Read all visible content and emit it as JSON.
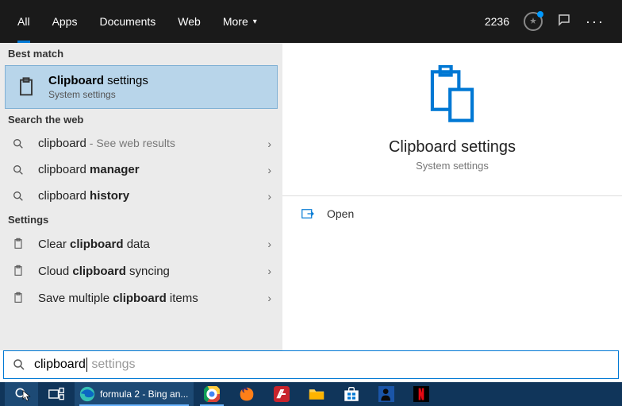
{
  "header": {
    "tabs": {
      "all": "All",
      "apps": "Apps",
      "documents": "Documents",
      "web": "Web",
      "more": "More"
    },
    "points": "2236"
  },
  "sections": {
    "bestMatch": "Best match",
    "searchWeb": "Search the web",
    "settings": "Settings"
  },
  "bestMatch": {
    "title_bold": "Clipboard",
    "title_rest": " settings",
    "subtitle": "System settings"
  },
  "webResults": {
    "r0": {
      "prefix": "clipboard",
      "sub": " - See web results"
    },
    "r1": {
      "prefix": "clipboard ",
      "bold": "manager"
    },
    "r2": {
      "prefix": "clipboard ",
      "bold": "history"
    }
  },
  "settingsResults": {
    "s0": {
      "a": "Clear ",
      "b": "clipboard",
      "c": " data"
    },
    "s1": {
      "a": "Cloud ",
      "b": "clipboard",
      "c": " syncing"
    },
    "s2": {
      "a": "Save multiple ",
      "b": "clipboard",
      "c": " items"
    }
  },
  "rightPane": {
    "title": "Clipboard settings",
    "subtitle": "System settings",
    "open": "Open"
  },
  "search": {
    "typed": "clipboard",
    "hint": " settings"
  },
  "taskbar": {
    "edgeTitle": "formula 2 - Bing an..."
  }
}
